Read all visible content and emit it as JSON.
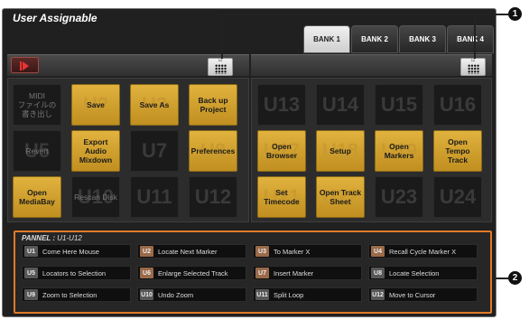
{
  "window": {
    "title": "User Assignable"
  },
  "banks": [
    {
      "label": "BANK 1",
      "active": true
    },
    {
      "label": "BANK 2",
      "active": false
    },
    {
      "label": "BANK 3",
      "active": false
    },
    {
      "label": "BANK 4",
      "active": false
    }
  ],
  "grid_button": {
    "sublabel": "12"
  },
  "left_pads": [
    {
      "label": "MIDI\nファイルの書き出し",
      "ghost": "",
      "lit": false
    },
    {
      "label": "Save",
      "ghost": "U2",
      "lit": true
    },
    {
      "label": "Save As",
      "ghost": "U3",
      "lit": true
    },
    {
      "label": "Back up\nProject",
      "ghost": "",
      "lit": true
    },
    {
      "label": "Revert",
      "ghost": "U5",
      "lit": false
    },
    {
      "label": "Export Audio\nMixdown",
      "ghost": "",
      "lit": true
    },
    {
      "label": "",
      "ghost": "U7",
      "lit": false
    },
    {
      "label": "Preferences",
      "ghost": "U8",
      "lit": true
    },
    {
      "label": "Open\nMediaBay",
      "ghost": "",
      "lit": true
    },
    {
      "label": "Rescan Disk",
      "ghost": "U10",
      "lit": false
    },
    {
      "label": "",
      "ghost": "U11",
      "lit": false
    },
    {
      "label": "",
      "ghost": "U12",
      "lit": false
    }
  ],
  "right_pads": [
    {
      "label": "",
      "ghost": "U13",
      "lit": false
    },
    {
      "label": "",
      "ghost": "U14",
      "lit": false
    },
    {
      "label": "",
      "ghost": "U15",
      "lit": false
    },
    {
      "label": "",
      "ghost": "U16",
      "lit": false
    },
    {
      "label": "Open\nBrowser",
      "ghost": "U17",
      "lit": true
    },
    {
      "label": "Setup",
      "ghost": "U18",
      "lit": true
    },
    {
      "label": "Open\nMarkers",
      "ghost": "U19",
      "lit": true
    },
    {
      "label": "Open Tempo\nTrack",
      "ghost": "",
      "lit": true
    },
    {
      "label": "Set Timecode",
      "ghost": "U21",
      "lit": true
    },
    {
      "label": "Open Track\nSheet",
      "ghost": "U22",
      "lit": true
    },
    {
      "label": "",
      "ghost": "U23",
      "lit": false
    },
    {
      "label": "",
      "ghost": "U24",
      "lit": false
    }
  ],
  "pannel": {
    "title_prefix": "PANNEL :",
    "title_range": "U1-U12",
    "items": [
      {
        "code": "U1",
        "text": "Come Here Mouse",
        "brown": false
      },
      {
        "code": "U2",
        "text": "Locate Next Marker",
        "brown": true
      },
      {
        "code": "U3",
        "text": "To Marker X",
        "brown": true
      },
      {
        "code": "U4",
        "text": "Recall Cycle Marker X",
        "brown": true
      },
      {
        "code": "U5",
        "text": "Locators to Selection",
        "brown": false
      },
      {
        "code": "U6",
        "text": "Enlarge Selected Track",
        "brown": true
      },
      {
        "code": "U7",
        "text": "Insert Marker",
        "brown": true
      },
      {
        "code": "U8",
        "text": "Locate Selection",
        "brown": false
      },
      {
        "code": "U9",
        "text": "Zoom to Selection",
        "brown": false
      },
      {
        "code": "U10",
        "text": "Undo Zoom",
        "brown": false
      },
      {
        "code": "U11",
        "text": "Split Loop",
        "brown": false
      },
      {
        "code": "U12",
        "text": "Move to Cursor",
        "brown": false
      }
    ]
  },
  "callouts": [
    "1",
    "2"
  ]
}
